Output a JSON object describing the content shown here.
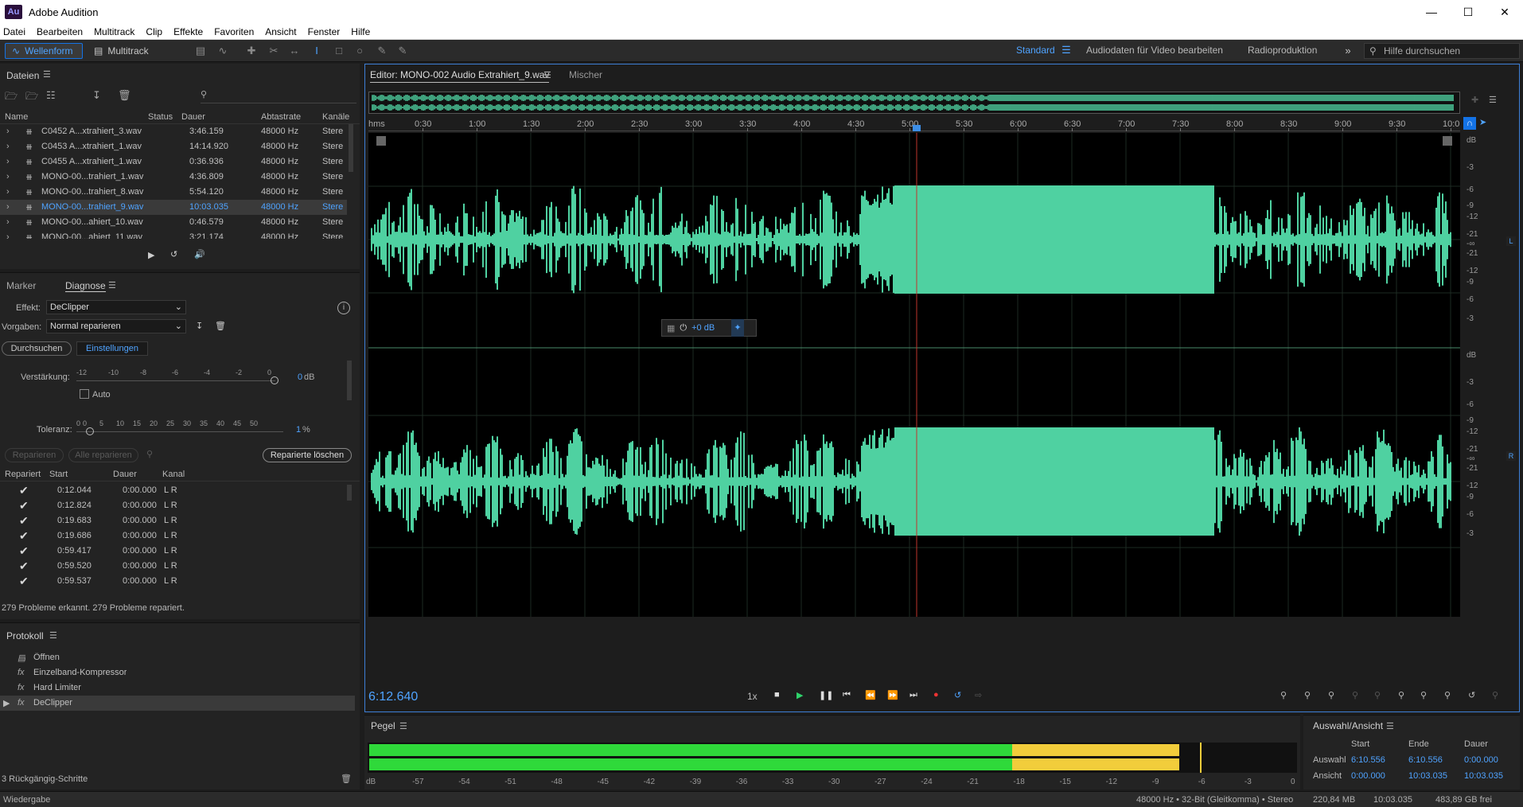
{
  "app": {
    "title": "Adobe Audition",
    "logo": "Au"
  },
  "menu": [
    "Datei",
    "Bearbeiten",
    "Multitrack",
    "Clip",
    "Effekte",
    "Favoriten",
    "Ansicht",
    "Fenster",
    "Hilfe"
  ],
  "toolbar": {
    "waveform_label": "Wellenform",
    "multitrack_label": "Multitrack",
    "workspaces": [
      "Standard",
      "Audiodaten für Video bearbeiten",
      "Radioproduktion"
    ],
    "help_placeholder": "Hilfe durchsuchen"
  },
  "files_panel": {
    "title": "Dateien",
    "columns": [
      "Name",
      "Status",
      "Dauer",
      "Abtastrate",
      "Kanäle"
    ],
    "rows": [
      {
        "name": "C0452 A...xtrahiert_3.wav",
        "duration": "3:46.159",
        "rate": "48000 Hz",
        "channels": "Stere",
        "selected": false
      },
      {
        "name": "C0453 A...xtrahiert_1.wav",
        "duration": "14:14.920",
        "rate": "48000 Hz",
        "channels": "Stere",
        "selected": false
      },
      {
        "name": "C0455 A...xtrahiert_1.wav",
        "duration": "0:36.936",
        "rate": "48000 Hz",
        "channels": "Stere",
        "selected": false
      },
      {
        "name": "MONO-00...trahiert_1.wav",
        "duration": "4:36.809",
        "rate": "48000 Hz",
        "channels": "Stere",
        "selected": false
      },
      {
        "name": "MONO-00...trahiert_8.wav",
        "duration": "5:54.120",
        "rate": "48000 Hz",
        "channels": "Stere",
        "selected": false
      },
      {
        "name": "MONO-00...trahiert_9.wav",
        "duration": "10:03.035",
        "rate": "48000 Hz",
        "channels": "Stere",
        "selected": true
      },
      {
        "name": "MONO-00...ahiert_10.wav",
        "duration": "0:46.579",
        "rate": "48000 Hz",
        "channels": "Stere",
        "selected": false
      },
      {
        "name": "MONO-00...ahiert_11.wav",
        "duration": "3:21.174",
        "rate": "48000 Hz",
        "channels": "Stere",
        "selected": false
      }
    ]
  },
  "diagnose_panel": {
    "tabs": [
      "Marker",
      "Diagnose"
    ],
    "effect_label": "Effekt:",
    "effect_value": "DeClipper",
    "preset_label": "Vorgaben:",
    "preset_value": "Normal reparieren",
    "subtabs": [
      "Durchsuchen",
      "Einstellungen"
    ],
    "gain_label": "Verstärkung:",
    "gain_ticks": [
      "-12",
      "-10",
      "-8",
      "-6",
      "-4",
      "-2",
      "0"
    ],
    "gain_value": "0",
    "gain_unit": "dB",
    "auto_label": "Auto",
    "tolerance_label": "Toleranz:",
    "tolerance_ticks": [
      "0",
      "0",
      "5",
      "10",
      "15",
      "20",
      "25",
      "30",
      "35",
      "40",
      "45",
      "50"
    ],
    "tolerance_value": "1",
    "tolerance_unit": "%",
    "repair_btn": "Reparieren",
    "repair_all_btn": "Alle reparieren",
    "delete_repaired_btn": "Reparierte löschen",
    "columns": [
      "Repariert",
      "Start",
      "Dauer",
      "Kanal"
    ],
    "rows": [
      {
        "start": "0:12.044",
        "duration": "0:00.000",
        "channel": "L R"
      },
      {
        "start": "0:12.824",
        "duration": "0:00.000",
        "channel": "L R"
      },
      {
        "start": "0:19.683",
        "duration": "0:00.000",
        "channel": "L R"
      },
      {
        "start": "0:19.686",
        "duration": "0:00.000",
        "channel": "L R"
      },
      {
        "start": "0:59.417",
        "duration": "0:00.000",
        "channel": "L R"
      },
      {
        "start": "0:59.520",
        "duration": "0:00.000",
        "channel": "L R"
      },
      {
        "start": "0:59.537",
        "duration": "0:00.000",
        "channel": "L R"
      }
    ],
    "summary": "279 Probleme erkannt. 279 Probleme repariert."
  },
  "history_panel": {
    "title": "Protokoll",
    "items": [
      "Öffnen",
      "Einzelband-Kompressor",
      "Hard Limiter",
      "DeClipper"
    ],
    "undo_steps": "3 Rückgängig-Schritte"
  },
  "editor": {
    "tab_title": "Editor: MONO-002 Audio Extrahiert_9.wav",
    "mixer_tab": "Mischer",
    "ruler_unit": "hms",
    "ruler_ticks": [
      "0:30",
      "1:00",
      "1:30",
      "2:00",
      "2:30",
      "3:00",
      "3:30",
      "4:00",
      "4:30",
      "5:00",
      "5:30",
      "6:00",
      "6:30",
      "7:00",
      "7:30",
      "8:00",
      "8:30",
      "9:00",
      "9:30",
      "10:0"
    ],
    "db_unit": "dB",
    "db_scale_top": [
      "-3",
      "-6",
      "-9",
      "-12",
      "-21",
      "-∞",
      "-21",
      "-12",
      "-9",
      "-6",
      "-3"
    ],
    "channel_left": "L",
    "channel_right": "R",
    "hud_gain": "+0 dB",
    "current_time": "6:12.640",
    "speed": "1x",
    "accent_color": "#4fd1a1"
  },
  "levels_panel": {
    "title": "Pegel",
    "scale": [
      "dB",
      "-57",
      "-54",
      "-51",
      "-48",
      "-45",
      "-42",
      "-39",
      "-36",
      "-33",
      "-30",
      "-27",
      "-24",
      "-21",
      "-18",
      "-15",
      "-12",
      "-9",
      "-6",
      "-3",
      "0"
    ]
  },
  "selection_panel": {
    "title": "Auswahl/Ansicht",
    "columns": [
      "Start",
      "Ende",
      "Dauer"
    ],
    "selection_label": "Auswahl",
    "selection": [
      "6:10.556",
      "6:10.556",
      "0:00.000"
    ],
    "view_label": "Ansicht",
    "view": [
      "0:00.000",
      "10:03.035",
      "10:03.035"
    ]
  },
  "status": {
    "left": "Wiedergabe",
    "format": "48000 Hz • 32-Bit (Gleitkomma) • Stereo",
    "size": "220,84 MB",
    "duration": "10:03.035",
    "free": "483,89 GB frei"
  }
}
